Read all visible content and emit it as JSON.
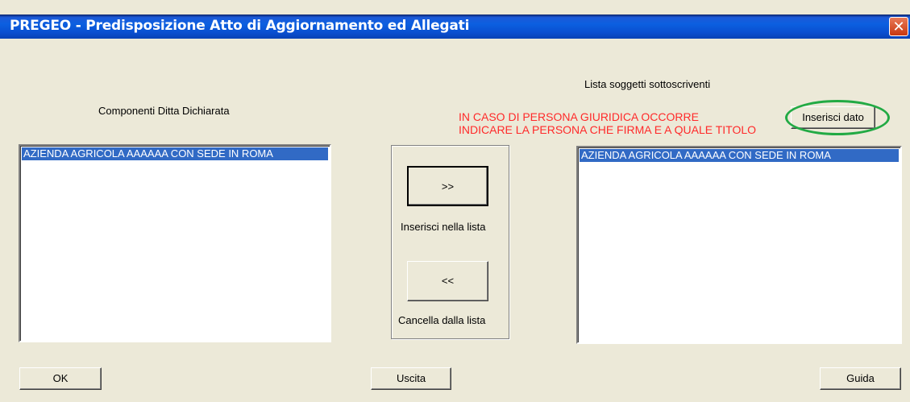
{
  "window": {
    "title": "PREGEO - Predisposizione Atto di Aggiornamento ed Allegati",
    "close_glyph": "✕"
  },
  "left": {
    "heading": "Componenti Ditta Dichiarata",
    "items": [
      "AZIENDA AGRICOLA AAAAAA CON SEDE IN ROMA"
    ]
  },
  "right": {
    "heading": "Lista soggetti sottoscriventi",
    "items": [
      "AZIENDA AGRICOLA AAAAAA CON SEDE IN ROMA"
    ]
  },
  "warning": {
    "line1": "IN CASO DI PERSONA GIURIDICA OCCORRE",
    "line2": "INDICARE LA PERSONA CHE FIRMA E A QUALE TITOLO",
    "color": "#ff2a2a"
  },
  "buttons": {
    "insert_data": "Inserisci dato",
    "add": ">>",
    "add_caption": "Inserisci nella lista",
    "remove": "<<",
    "remove_caption": "Cancella dalla lista",
    "ok": "OK",
    "exit": "Uscita",
    "help": "Guida"
  },
  "highlight_color": "#22aa44",
  "selection_color": "#316ac5"
}
